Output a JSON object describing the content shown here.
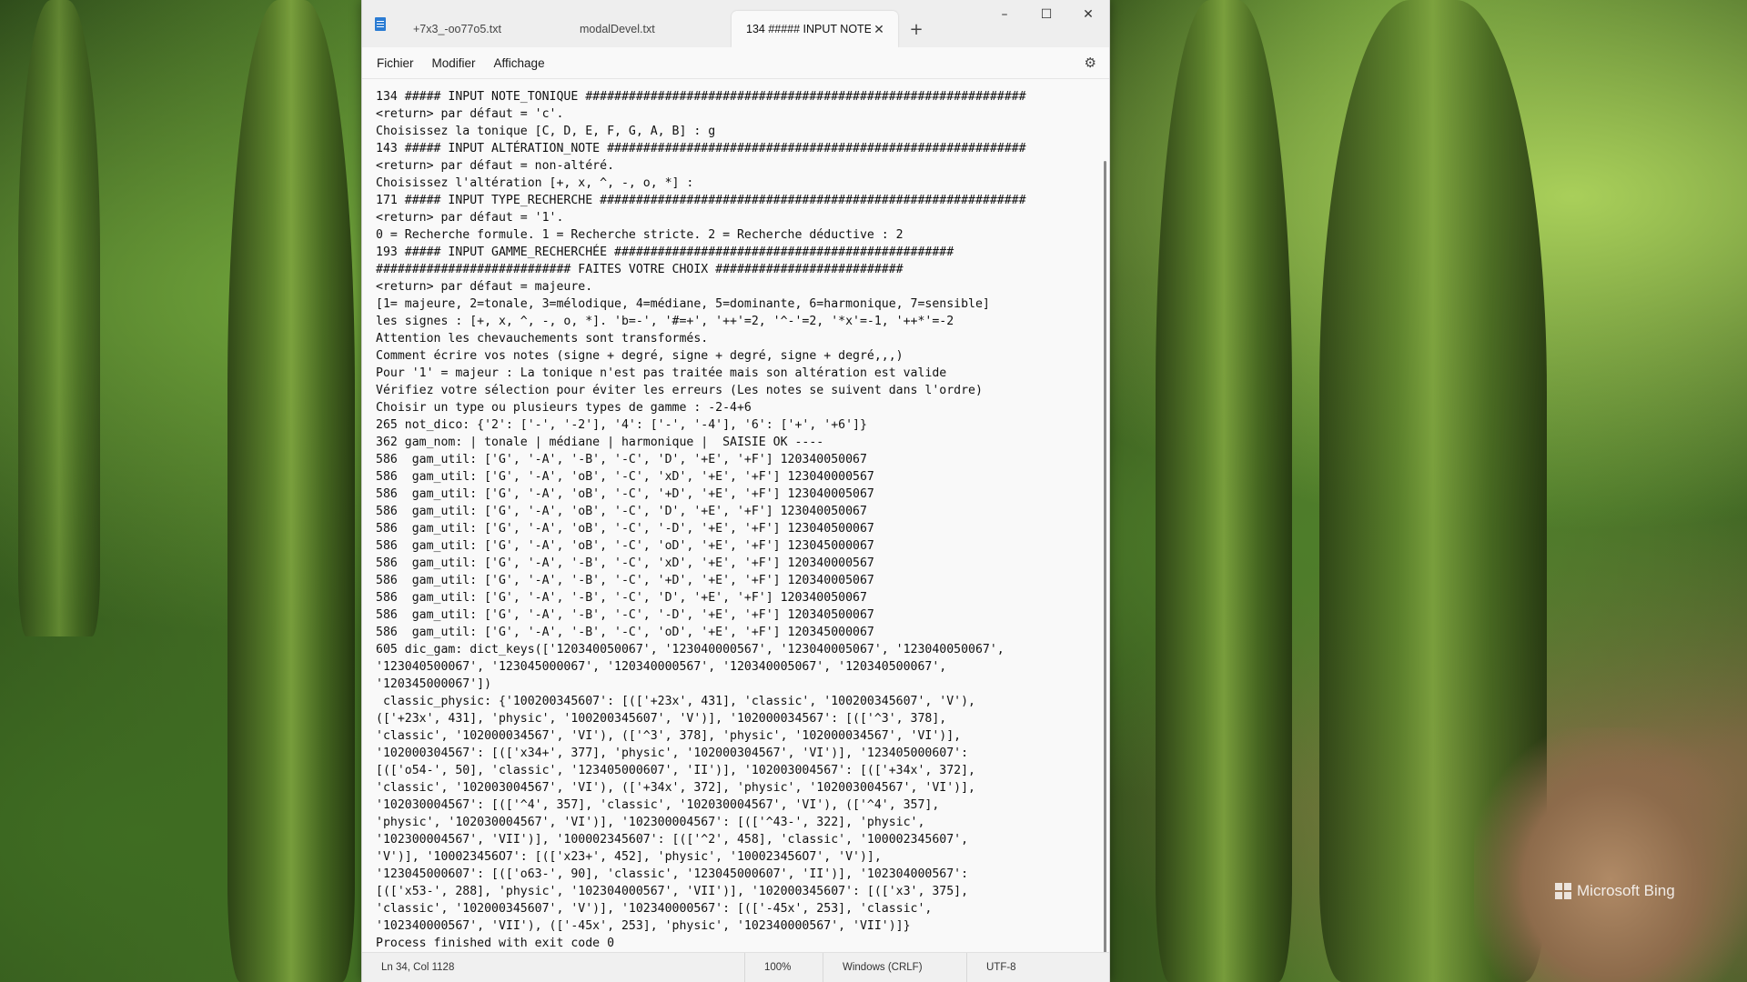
{
  "desktop": {
    "watermark": "Microsoft Bing"
  },
  "window": {
    "tabs": [
      {
        "label": "+7x3_-oo77o5.txt",
        "active": false
      },
      {
        "label": "modalDevel.txt",
        "active": false
      },
      {
        "label": "134 ##### INPUT NOTE_",
        "active": true
      }
    ],
    "new_tab": "+",
    "controls": {
      "minimize": "–",
      "maximize": "☐",
      "close": "✕"
    },
    "tab_close": "✕"
  },
  "menu": {
    "items": [
      "Fichier",
      "Modifier",
      "Affichage"
    ],
    "settings_icon": "gear-icon"
  },
  "editor": {
    "lines": [
      "134 ##### INPUT NOTE_TONIQUE #############################################################",
      "<return> par défaut = 'c'.",
      "Choisissez la tonique [C, D, E, F, G, A, B] : g",
      "143 ##### INPUT ALTÉRATION_NOTE ##########################################################",
      "<return> par défaut = non-altéré.",
      "Choisissez l'altération [+, x, ^, -, o, *] :",
      "171 ##### INPUT TYPE_RECHERCHE ###########################################################",
      "<return> par défaut = '1'.",
      "0 = Recherche formule. 1 = Recherche stricte. 2 = Recherche déductive : 2",
      "193 ##### INPUT GAMME_RECHERCHÉE ###############################################",
      "########################### FAITES VOTRE CHOIX ##########################",
      "<return> par défaut = majeure.",
      "[1= majeure, 2=tonale, 3=mélodique, 4=médiane, 5=dominante, 6=harmonique, 7=sensible]",
      "les signes : [+, x, ^, -, o, *]. 'b=-', '#=+', '++'=2, '^-'=2, '*x'=-1, '++*'=-2",
      "Attention les chevauchements sont transformés.",
      "Comment écrire vos notes (signe + degré, signe + degré, signe + degré,,,)",
      "Pour '1' = majeur : La tonique n'est pas traitée mais son altération est valide",
      "Vérifiez votre sélection pour éviter les erreurs (Les notes se suivent dans l'ordre)",
      "Choisir un type ou plusieurs types de gamme : -2-4+6",
      "265 not_dico: {'2': ['-', '-2'], '4': ['-', '-4'], '6': ['+', '+6']}",
      "362 gam_nom: | tonale | médiane | harmonique |  SAISIE OK ----",
      "586  gam_util: ['G', '-A', '-B', '-C', 'D', '+E', '+F'] 120340050067",
      "586  gam_util: ['G', '-A', 'oB', '-C', 'xD', '+E', '+F'] 123040000567",
      "586  gam_util: ['G', '-A', 'oB', '-C', '+D', '+E', '+F'] 123040005067",
      "586  gam_util: ['G', '-A', 'oB', '-C', 'D', '+E', '+F'] 123040050067",
      "586  gam_util: ['G', '-A', 'oB', '-C', '-D', '+E', '+F'] 123040500067",
      "586  gam_util: ['G', '-A', 'oB', '-C', 'oD', '+E', '+F'] 123045000067",
      "586  gam_util: ['G', '-A', '-B', '-C', 'xD', '+E', '+F'] 120340000567",
      "586  gam_util: ['G', '-A', '-B', '-C', '+D', '+E', '+F'] 120340005067",
      "586  gam_util: ['G', '-A', '-B', '-C', 'D', '+E', '+F'] 120340050067",
      "586  gam_util: ['G', '-A', '-B', '-C', '-D', '+E', '+F'] 120340500067",
      "586  gam_util: ['G', '-A', '-B', '-C', 'oD', '+E', '+F'] 120345000067",
      "605 dic_gam: dict_keys(['120340050067', '123040000567', '123040005067', '123040050067',",
      "'123040500067', '123045000067', '120340000567', '120340005067', '120340500067',",
      "'120345000067'])",
      " classic_physic: {'100200345607': [(['+23x', 431], 'classic', '100200345607', 'V'),",
      "(['+23x', 431], 'physic', '100200345607', 'V')], '102000034567': [(['^3', 378],",
      "'classic', '102000034567', 'VI'), (['^3', 378], 'physic', '102000034567', 'VI')],",
      "'102000304567': [(['x34+', 377], 'physic', '102000304567', 'VI')], '123405000607':",
      "[(['o54-', 50], 'classic', '123405000607', 'II')], '102003004567': [(['+34x', 372],",
      "'classic', '102003004567', 'VI'), (['+34x', 372], 'physic', '102003004567', 'VI')],",
      "'102030004567': [(['^4', 357], 'classic', '102030004567', 'VI'), (['^4', 357],",
      "'physic', '102030004567', 'VI')], '102300004567': [(['^43-', 322], 'physic',",
      "'102300004567', 'VII')], '100002345607': [(['^2', 458], 'classic', '100002345607',",
      "'V')], '100023456O7': [(['x23+', 452], 'physic', '100023456O7', 'V')],",
      "'123045000607': [(['o63-', 90], 'classic', '123045000607', 'II')], '102304000567':",
      "[(['x53-', 288], 'physic', '102304000567', 'VII')], '102000345607': [(['x3', 375],",
      "'classic', '102000345607', 'V')], '102340000567': [(['-45x', 253], 'classic',",
      "'102340000567', 'VII'), (['-45x', 253], 'physic', '102340000567', 'VII')]}",
      "Process finished with exit code 0"
    ]
  },
  "status": {
    "position": "Ln 34, Col 1128",
    "zoom": "100%",
    "line_ending": "Windows (CRLF)",
    "encoding": "UTF-8"
  }
}
